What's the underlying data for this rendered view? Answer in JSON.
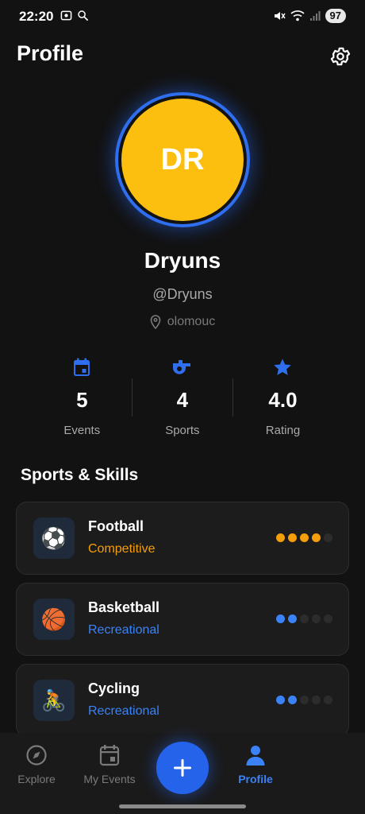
{
  "status_bar": {
    "time": "22:20",
    "battery": "97"
  },
  "header": {
    "title": "Profile"
  },
  "profile": {
    "initials": "DR",
    "name": "Dryuns",
    "handle": "@Dryuns",
    "location": "olomouc",
    "avatar_color": "#fdbf0f",
    "ring_color": "#2f6fef"
  },
  "stats": [
    {
      "value": "5",
      "label": "Events",
      "icon": "calendar-icon"
    },
    {
      "value": "4",
      "label": "Sports",
      "icon": "whistle-icon"
    },
    {
      "value": "4.0",
      "label": "Rating",
      "icon": "star-icon"
    }
  ],
  "sports_section": {
    "title": "Sports & Skills",
    "items": [
      {
        "emoji": "⚽",
        "name": "Football",
        "level": "Competitive",
        "level_color": "#f59e0b",
        "skill": 4,
        "max_skill": 5
      },
      {
        "emoji": "🏀",
        "name": "Basketball",
        "level": "Recreational",
        "level_color": "#3b82f6",
        "skill": 2,
        "max_skill": 5
      },
      {
        "emoji": "🚴",
        "name": "Cycling",
        "level": "Recreational",
        "level_color": "#3b82f6",
        "skill": 2,
        "max_skill": 5
      }
    ]
  },
  "bottom_nav": {
    "items": [
      {
        "label": "Explore",
        "icon": "compass-icon",
        "active": false
      },
      {
        "label": "My Events",
        "icon": "calendar-icon",
        "active": false
      },
      {
        "label": "Profile",
        "icon": "person-icon",
        "active": true
      }
    ],
    "fab_icon": "plus-icon"
  },
  "colors": {
    "accent": "#2563eb",
    "background": "#121212",
    "card": "#1c1c1c"
  }
}
